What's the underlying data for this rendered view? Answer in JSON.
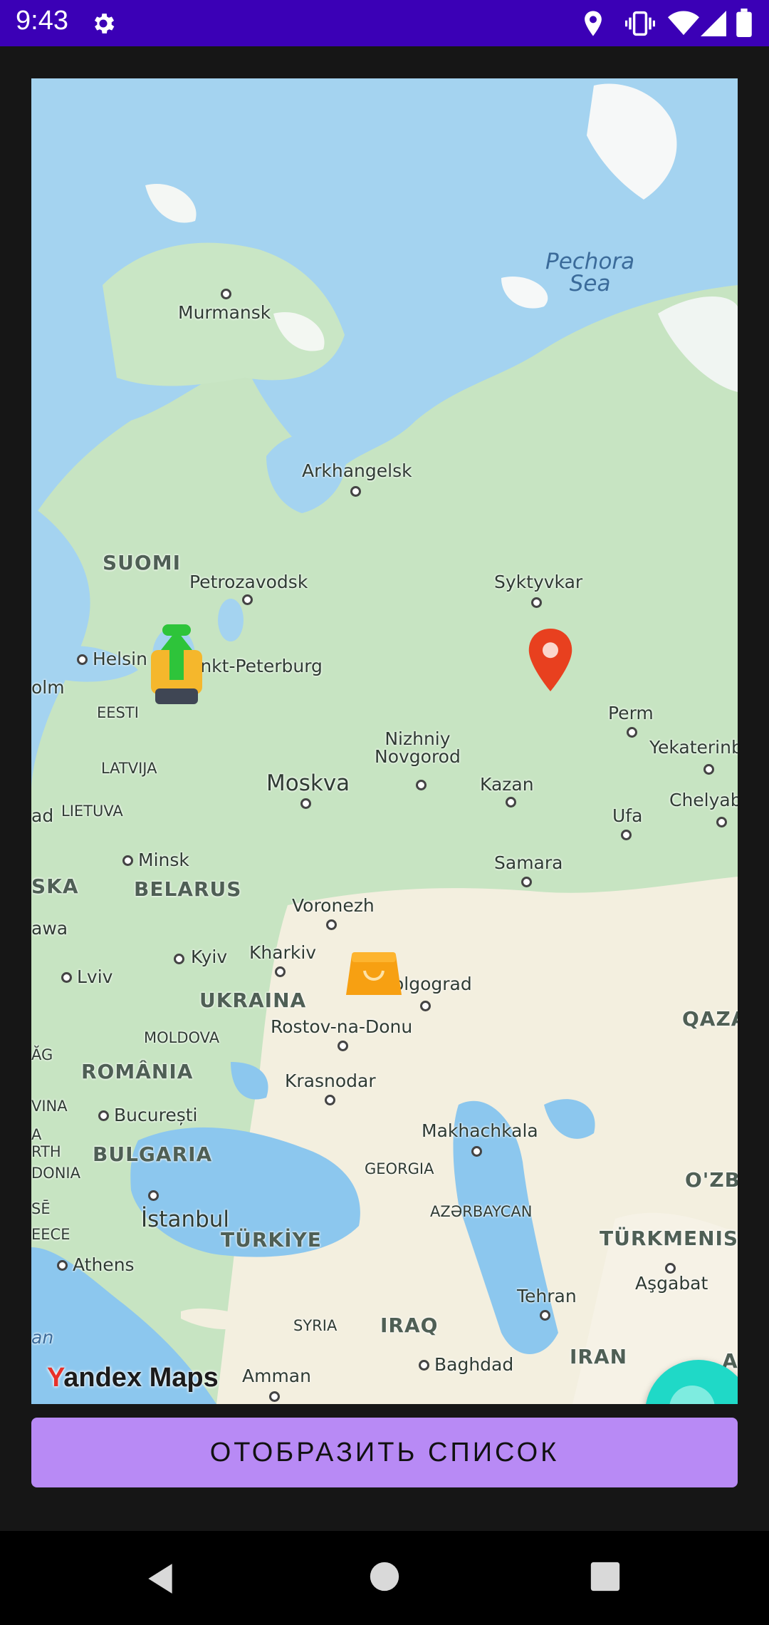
{
  "status_bar": {
    "time": "9:43",
    "icons": [
      "settings-icon",
      "location-icon",
      "vibrate-icon",
      "wifi-icon",
      "signal-icon",
      "battery-icon"
    ]
  },
  "map": {
    "provider_logo": {
      "y": "Y",
      "rest": "andex Maps"
    },
    "seas": [
      {
        "name": "Pechora\nSea"
      }
    ],
    "cities": {
      "murmansk": "Murmansk",
      "arkhangelsk": "Arkhangelsk",
      "petrozavodsk": "Petrozavodsk",
      "syktyvkar": "Syktyvkar",
      "helsinki": "Helsin",
      "spb": "ankt-Peterburg",
      "stockholm": "olm",
      "perm": "Perm",
      "yekaterinburg": "Yekaterinb",
      "nizhniy": "Nizhniy\nNovgorod",
      "moskva": "Moskva",
      "kazan": "Kazan",
      "ufa": "Ufa",
      "chelyabinsk": "Chelyab",
      "riga": "ad",
      "minsk": "Minsk",
      "samara": "Samara",
      "voronezh": "Voronezh",
      "warsaw": "awa",
      "kharkiv": "Kharkiv",
      "kyiv": "Kyiv",
      "lviv": "Lviv",
      "volgograd": "olgograd",
      "rostov": "Rostov-na-Donu",
      "krasnodar": "Krasnodar",
      "bucuresti": "București",
      "makhachkala": "Makhachkala",
      "istanbul": "İstanbul",
      "athens": "Athens",
      "tehran": "Tehran",
      "ashgabat": "Aşgabat",
      "baghdad": "Baghdad",
      "amman": "Amman",
      "an": "an"
    },
    "countries": {
      "suomi": "SUOMI",
      "eesti": "EESTI",
      "latvija": "LATVIJA",
      "lietuva": "LIETUVA",
      "polska": "SKA",
      "belarus": "BELARUS",
      "ukraina": "UKRAINA",
      "moldova": "MOLDOVA",
      "romania": "ROMÂNIA",
      "ag": "ĂG",
      "vina": "VINA",
      "a": "A",
      "rth": "RTH",
      "donia": "DONIA",
      "se": "SĒ",
      "eece": "EECE",
      "bulgaria": "BULGARIA",
      "georgia": "GEORGIA",
      "azerbaycan": "AZƏRBAYCAN",
      "turkiye": "TÜRKİYE",
      "qazaq": "QAZA",
      "ozbek": "O'ZBE",
      "turkmenistan": "TÜRKMENIST",
      "syria": "SYRIA",
      "iraq": "IRAQ",
      "iran": "IRAN",
      "af": "A"
    },
    "markers": [
      "backpack-marker-icon",
      "location-pin-icon",
      "shopping-bag-marker-icon"
    ]
  },
  "fab": {
    "icon": "chat-search-icon"
  },
  "show_list_button": {
    "label": "ОТОБРАЗИТЬ СПИСОК"
  },
  "nav_bar": {
    "icons": [
      "back-icon",
      "home-icon",
      "recents-icon"
    ]
  },
  "colors": {
    "status_bar": "#3b00b6",
    "button": "#b88af5",
    "fab": "#1fd9c7",
    "pin": "#e8401f",
    "land": "#c8e6c4",
    "water": "#a4d3f0"
  }
}
